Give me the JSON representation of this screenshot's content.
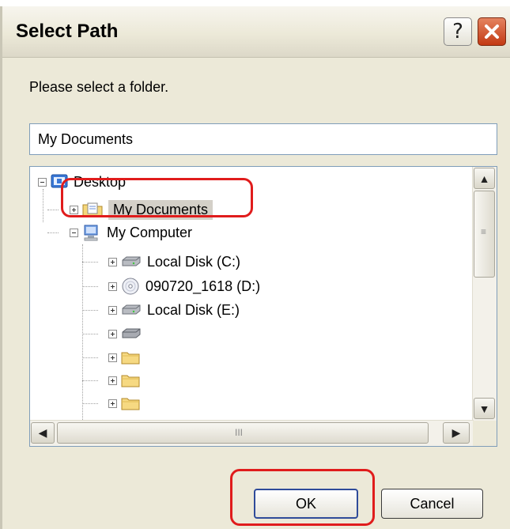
{
  "window": {
    "title": "Select Path"
  },
  "titlebar_buttons": {
    "help": "?",
    "close": "✕"
  },
  "dialog": {
    "prompt": "Please select a folder.",
    "path_value": "My Documents"
  },
  "tree": {
    "items": [
      {
        "label": "Desktop",
        "icon": "desktop-icon",
        "expanded": true
      },
      {
        "label": "My Documents",
        "icon": "my-documents-folder-icon",
        "selected": true
      },
      {
        "label": "My Computer",
        "icon": "my-computer-icon",
        "expanded": true
      },
      {
        "label": "Local Disk (C:)",
        "icon": "hard-drive-icon"
      },
      {
        "label": "090720_1618 (D:)",
        "icon": "cd-drive-icon"
      },
      {
        "label": "Local Disk (E:)",
        "icon": "hard-drive-icon"
      },
      {
        "label": "",
        "icon": "hard-drive-icon"
      },
      {
        "label": "",
        "icon": "folder-icon"
      },
      {
        "label": "",
        "icon": "folder-icon"
      },
      {
        "label": "",
        "icon": "folder-icon"
      }
    ]
  },
  "scrollbars": {
    "up": "▲",
    "down": "▼",
    "left": "◀",
    "right": "▶",
    "v_grip": "≡",
    "h_grip": "III"
  },
  "buttons": {
    "ok": "OK",
    "cancel": "Cancel"
  },
  "colors": {
    "annotation": "#e01c1c",
    "titlebar": "#ece9d8",
    "close_button": "#c33a14",
    "input_border": "#7f9db9"
  }
}
